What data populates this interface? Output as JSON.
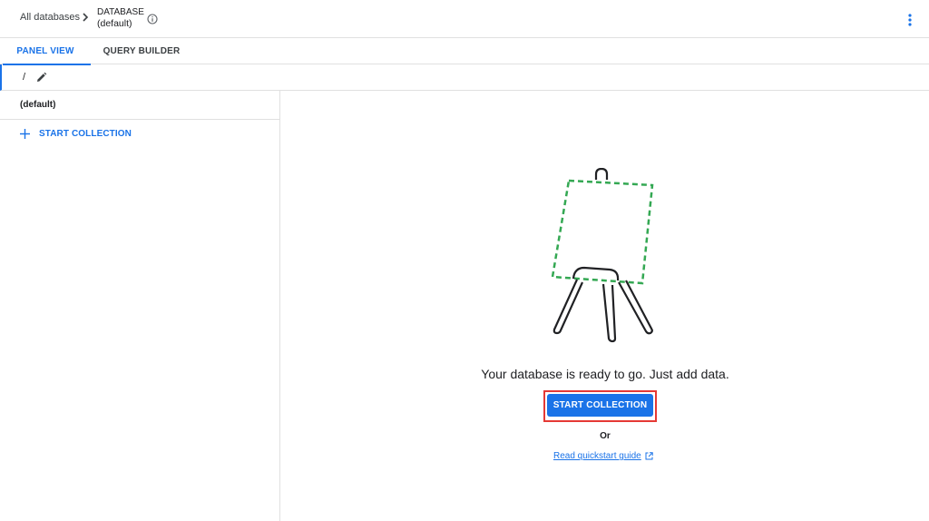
{
  "breadcrumb": {
    "root": "All databases",
    "db_label": "DATABASE",
    "db_name": "(default)"
  },
  "icons": {
    "chevron": "chevron-right-icon",
    "info": "info-icon",
    "more": "more-vert-icon",
    "edit": "pencil-icon",
    "add": "plus-icon",
    "external": "external-link-icon"
  },
  "tabs": [
    {
      "label": "PANEL VIEW",
      "active": true
    },
    {
      "label": "QUERY BUILDER",
      "active": false
    }
  ],
  "path": {
    "text": "/"
  },
  "left_panel": {
    "title": "(default)",
    "add_label": "START COLLECTION"
  },
  "main": {
    "message": "Your database is ready to go. Just add data.",
    "cta_label": "START COLLECTION",
    "or_text": "Or",
    "guide_label": "Read quickstart guide"
  },
  "colors": {
    "accent": "#1a73e8",
    "highlight": "#e53935",
    "canvas_dashes": "#34a853"
  }
}
